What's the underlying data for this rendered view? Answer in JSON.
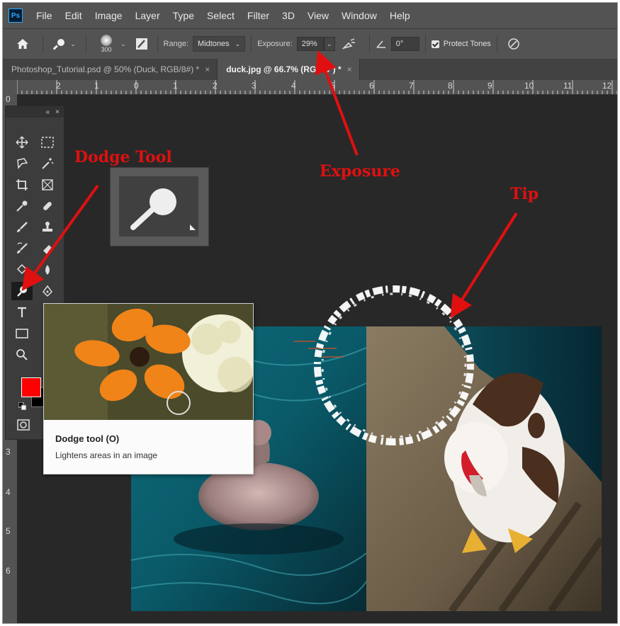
{
  "app": {
    "logo": "Ps"
  },
  "menu": [
    "File",
    "Edit",
    "Image",
    "Layer",
    "Type",
    "Select",
    "Filter",
    "3D",
    "View",
    "Window",
    "Help"
  ],
  "options": {
    "brush_size": "300",
    "range_label": "Range:",
    "range_value": "Midtones",
    "exposure_label": "Exposure:",
    "exposure_value": "29%",
    "angle_value": "0°",
    "protect_tones_label": "Protect Tones"
  },
  "tabs": [
    {
      "label": "Photoshop_Tutorial.psd @ 50% (Duck, RGB/8#) *",
      "close": "×"
    },
    {
      "label": "duck.jpg @ 66.7% (RGB/8*) *",
      "close": "×"
    }
  ],
  "ruler": {
    "h_labels": [
      "0",
      "2",
      "1",
      "0",
      "1",
      "2",
      "3",
      "4",
      "5",
      "6",
      "7",
      "8",
      "9",
      "10",
      "11",
      "12"
    ],
    "v_labels": [
      "0",
      "3",
      "4",
      "5",
      "6"
    ]
  },
  "toolbar": {
    "collapse": "«",
    "close": "×"
  },
  "tooltip": {
    "title": "Dodge tool (O)",
    "description": "Lightens areas in an image"
  },
  "annotations": {
    "dodge_tool": "Dodge Tool",
    "exposure": "Exposure",
    "tip": "Tip"
  },
  "colors": {
    "foreground": "#ff0000",
    "background": "#000000",
    "annotation": "#e01010"
  }
}
